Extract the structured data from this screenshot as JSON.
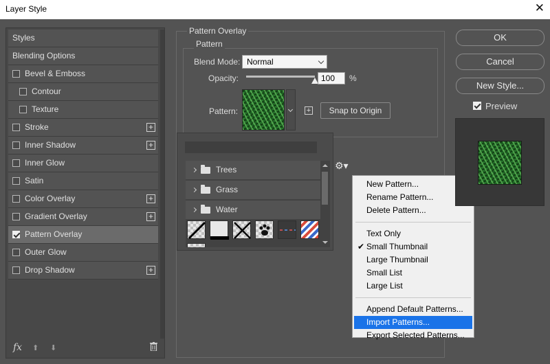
{
  "window": {
    "title": "Layer Style",
    "close_glyph": "✕"
  },
  "styles_panel": {
    "items": [
      {
        "label": "Styles",
        "type": "header"
      },
      {
        "label": "Blending Options",
        "type": "header"
      },
      {
        "label": "Bevel & Emboss",
        "checked": false,
        "plus": false
      },
      {
        "label": "Contour",
        "checked": false,
        "plus": false,
        "indent": true
      },
      {
        "label": "Texture",
        "checked": false,
        "plus": false,
        "indent": true
      },
      {
        "label": "Stroke",
        "checked": false,
        "plus": true
      },
      {
        "label": "Inner Shadow",
        "checked": false,
        "plus": true
      },
      {
        "label": "Inner Glow",
        "checked": false,
        "plus": false
      },
      {
        "label": "Satin",
        "checked": false,
        "plus": false
      },
      {
        "label": "Color Overlay",
        "checked": false,
        "plus": true
      },
      {
        "label": "Gradient Overlay",
        "checked": false,
        "plus": true
      },
      {
        "label": "Pattern Overlay",
        "checked": true,
        "plus": false,
        "selected": true
      },
      {
        "label": "Outer Glow",
        "checked": false,
        "plus": false
      },
      {
        "label": "Drop Shadow",
        "checked": false,
        "plus": true
      }
    ],
    "footer": {
      "fx_label": "fx",
      "up_glyph": "⬆",
      "down_glyph": "⬇"
    }
  },
  "pattern_overlay": {
    "group_title": "Pattern Overlay",
    "subgroup_title": "Pattern",
    "blend_mode_label": "Blend Mode:",
    "blend_mode_value": "Normal",
    "opacity_label": "Opacity:",
    "opacity_value": "100",
    "opacity_unit": "%",
    "opacity_fraction": 1.0,
    "pattern_label": "Pattern:",
    "new_preset_glyph": "+",
    "snap_button": "Snap to Origin"
  },
  "pattern_picker": {
    "folders": [
      {
        "name": "Trees"
      },
      {
        "name": "Grass"
      },
      {
        "name": "Water"
      }
    ],
    "gear_glyph": "⚙▾"
  },
  "menu": {
    "groups": [
      [
        "New Pattern...",
        "Rename Pattern...",
        "Delete Pattern..."
      ],
      [
        "Text Only",
        "Small Thumbnail",
        "Large Thumbnail",
        "Small List",
        "Large List"
      ],
      [
        "Append Default Patterns...",
        "Import Patterns...",
        "Export Selected Patterns..."
      ]
    ],
    "checked_item": "Small Thumbnail",
    "highlighted_item": "Import Patterns...",
    "check_glyph": "✔"
  },
  "buttons": {
    "ok": "OK",
    "cancel": "Cancel",
    "new_style": "New Style..."
  },
  "preview": {
    "label": "Preview",
    "checked": true
  },
  "colors": {
    "dialog_bg": "#535353",
    "highlight": "#1a73e8",
    "selected_row": "#6b6b6b"
  }
}
